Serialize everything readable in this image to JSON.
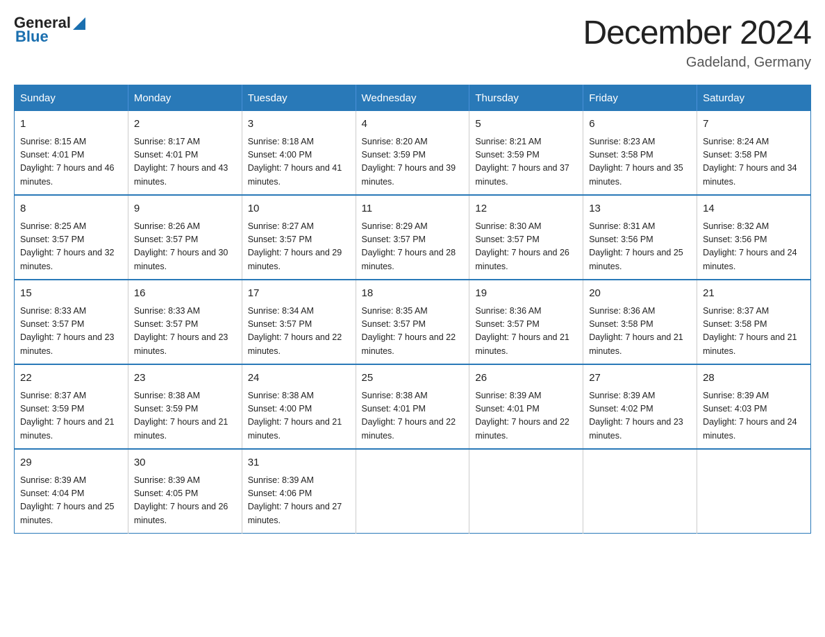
{
  "header": {
    "logo_general": "General",
    "logo_blue": "Blue",
    "month_title": "December 2024",
    "location": "Gadeland, Germany"
  },
  "days_of_week": [
    "Sunday",
    "Monday",
    "Tuesday",
    "Wednesday",
    "Thursday",
    "Friday",
    "Saturday"
  ],
  "weeks": [
    [
      {
        "day": "1",
        "sunrise": "8:15 AM",
        "sunset": "4:01 PM",
        "daylight": "7 hours and 46 minutes."
      },
      {
        "day": "2",
        "sunrise": "8:17 AM",
        "sunset": "4:01 PM",
        "daylight": "7 hours and 43 minutes."
      },
      {
        "day": "3",
        "sunrise": "8:18 AM",
        "sunset": "4:00 PM",
        "daylight": "7 hours and 41 minutes."
      },
      {
        "day": "4",
        "sunrise": "8:20 AM",
        "sunset": "3:59 PM",
        "daylight": "7 hours and 39 minutes."
      },
      {
        "day": "5",
        "sunrise": "8:21 AM",
        "sunset": "3:59 PM",
        "daylight": "7 hours and 37 minutes."
      },
      {
        "day": "6",
        "sunrise": "8:23 AM",
        "sunset": "3:58 PM",
        "daylight": "7 hours and 35 minutes."
      },
      {
        "day": "7",
        "sunrise": "8:24 AM",
        "sunset": "3:58 PM",
        "daylight": "7 hours and 34 minutes."
      }
    ],
    [
      {
        "day": "8",
        "sunrise": "8:25 AM",
        "sunset": "3:57 PM",
        "daylight": "7 hours and 32 minutes."
      },
      {
        "day": "9",
        "sunrise": "8:26 AM",
        "sunset": "3:57 PM",
        "daylight": "7 hours and 30 minutes."
      },
      {
        "day": "10",
        "sunrise": "8:27 AM",
        "sunset": "3:57 PM",
        "daylight": "7 hours and 29 minutes."
      },
      {
        "day": "11",
        "sunrise": "8:29 AM",
        "sunset": "3:57 PM",
        "daylight": "7 hours and 28 minutes."
      },
      {
        "day": "12",
        "sunrise": "8:30 AM",
        "sunset": "3:57 PM",
        "daylight": "7 hours and 26 minutes."
      },
      {
        "day": "13",
        "sunrise": "8:31 AM",
        "sunset": "3:56 PM",
        "daylight": "7 hours and 25 minutes."
      },
      {
        "day": "14",
        "sunrise": "8:32 AM",
        "sunset": "3:56 PM",
        "daylight": "7 hours and 24 minutes."
      }
    ],
    [
      {
        "day": "15",
        "sunrise": "8:33 AM",
        "sunset": "3:57 PM",
        "daylight": "7 hours and 23 minutes."
      },
      {
        "day": "16",
        "sunrise": "8:33 AM",
        "sunset": "3:57 PM",
        "daylight": "7 hours and 23 minutes."
      },
      {
        "day": "17",
        "sunrise": "8:34 AM",
        "sunset": "3:57 PM",
        "daylight": "7 hours and 22 minutes."
      },
      {
        "day": "18",
        "sunrise": "8:35 AM",
        "sunset": "3:57 PM",
        "daylight": "7 hours and 22 minutes."
      },
      {
        "day": "19",
        "sunrise": "8:36 AM",
        "sunset": "3:57 PM",
        "daylight": "7 hours and 21 minutes."
      },
      {
        "day": "20",
        "sunrise": "8:36 AM",
        "sunset": "3:58 PM",
        "daylight": "7 hours and 21 minutes."
      },
      {
        "day": "21",
        "sunrise": "8:37 AM",
        "sunset": "3:58 PM",
        "daylight": "7 hours and 21 minutes."
      }
    ],
    [
      {
        "day": "22",
        "sunrise": "8:37 AM",
        "sunset": "3:59 PM",
        "daylight": "7 hours and 21 minutes."
      },
      {
        "day": "23",
        "sunrise": "8:38 AM",
        "sunset": "3:59 PM",
        "daylight": "7 hours and 21 minutes."
      },
      {
        "day": "24",
        "sunrise": "8:38 AM",
        "sunset": "4:00 PM",
        "daylight": "7 hours and 21 minutes."
      },
      {
        "day": "25",
        "sunrise": "8:38 AM",
        "sunset": "4:01 PM",
        "daylight": "7 hours and 22 minutes."
      },
      {
        "day": "26",
        "sunrise": "8:39 AM",
        "sunset": "4:01 PM",
        "daylight": "7 hours and 22 minutes."
      },
      {
        "day": "27",
        "sunrise": "8:39 AM",
        "sunset": "4:02 PM",
        "daylight": "7 hours and 23 minutes."
      },
      {
        "day": "28",
        "sunrise": "8:39 AM",
        "sunset": "4:03 PM",
        "daylight": "7 hours and 24 minutes."
      }
    ],
    [
      {
        "day": "29",
        "sunrise": "8:39 AM",
        "sunset": "4:04 PM",
        "daylight": "7 hours and 25 minutes."
      },
      {
        "day": "30",
        "sunrise": "8:39 AM",
        "sunset": "4:05 PM",
        "daylight": "7 hours and 26 minutes."
      },
      {
        "day": "31",
        "sunrise": "8:39 AM",
        "sunset": "4:06 PM",
        "daylight": "7 hours and 27 minutes."
      },
      null,
      null,
      null,
      null
    ]
  ],
  "labels": {
    "sunrise_prefix": "Sunrise: ",
    "sunset_prefix": "Sunset: ",
    "daylight_prefix": "Daylight: "
  }
}
